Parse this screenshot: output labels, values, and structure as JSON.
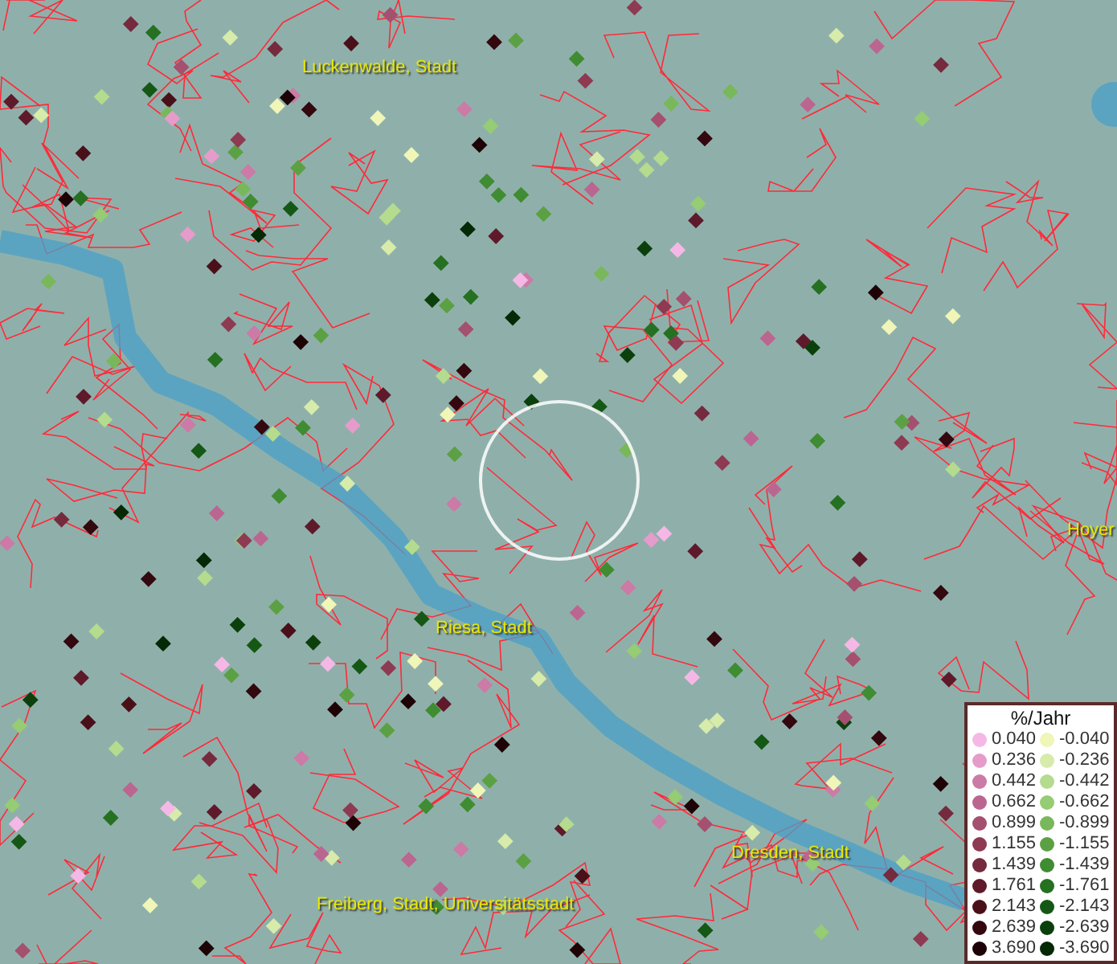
{
  "map": {
    "labels": [
      {
        "text": "Luckenwalde, Stadt"
      },
      {
        "text": "Riesa, Stadt"
      },
      {
        "text": "Dresden, Stadt"
      },
      {
        "text": "Freiberg, Stadt, Universitätsstadt"
      },
      {
        "text": "Hoyer"
      }
    ]
  },
  "legend": {
    "title": "%/Jahr",
    "positive": [
      {
        "label": "0.040",
        "color": "#f5b8e6"
      },
      {
        "label": "0.236",
        "color": "#e59ccb"
      },
      {
        "label": "0.442",
        "color": "#cc7aa6"
      },
      {
        "label": "0.662",
        "color": "#bb6690"
      },
      {
        "label": "0.899",
        "color": "#a4506e"
      },
      {
        "label": "1.155",
        "color": "#8e3a52"
      },
      {
        "label": "1.439",
        "color": "#762a3e"
      },
      {
        "label": "1.761",
        "color": "#5e1a2a"
      },
      {
        "label": "2.143",
        "color": "#4a1019"
      },
      {
        "label": "2.639",
        "color": "#33080e"
      },
      {
        "label": "3.690",
        "color": "#1e0306"
      }
    ],
    "negative": [
      {
        "label": "-0.040",
        "color": "#f0f5b8"
      },
      {
        "label": "-0.236",
        "color": "#d7ebaa"
      },
      {
        "label": "-0.442",
        "color": "#b4db8e"
      },
      {
        "label": "-0.662",
        "color": "#95cc74"
      },
      {
        "label": "-0.899",
        "color": "#78b85a"
      },
      {
        "label": "-1.155",
        "color": "#5ca044"
      },
      {
        "label": "-1.439",
        "color": "#3f8c32"
      },
      {
        "label": "-1.761",
        "color": "#267022"
      },
      {
        "label": "-2.143",
        "color": "#155816"
      },
      {
        "label": "-2.639",
        "color": "#0b400c"
      },
      {
        "label": "-3.690",
        "color": "#052805"
      }
    ]
  }
}
